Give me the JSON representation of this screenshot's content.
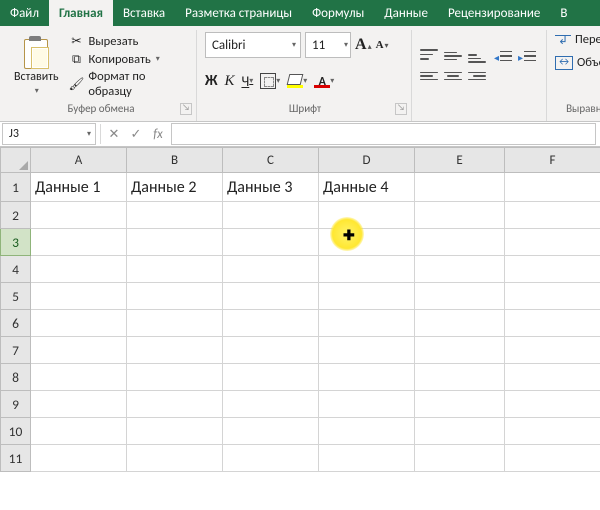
{
  "tabs": {
    "file": "Файл",
    "home": "Главная",
    "insert": "Вставка",
    "pagelayout": "Разметка страницы",
    "formulas": "Формулы",
    "data": "Данные",
    "review": "Рецензирование",
    "view_initial": "В"
  },
  "clipboard": {
    "paste": "Вставить",
    "cut": "Вырезать",
    "copy": "Копировать",
    "format_painter": "Формат по образцу",
    "group_label": "Буфер обмена"
  },
  "font": {
    "name": "Calibri",
    "size": "11",
    "bold": "Ж",
    "italic": "К",
    "underline": "Ч",
    "group_label": "Шрифт",
    "color_letter": "А"
  },
  "alignment": {
    "wrap": "Перенос",
    "merge": "Объеди",
    "group_label": "Выравниван"
  },
  "namebox": {
    "ref": "J3",
    "fx": "fx"
  },
  "columns": [
    "A",
    "B",
    "C",
    "D",
    "E",
    "F"
  ],
  "rows": [
    "1",
    "2",
    "3",
    "4",
    "5",
    "6",
    "7",
    "8",
    "9",
    "10",
    "11"
  ],
  "cells": {
    "A1": "Данные 1",
    "B1": "Данные 2",
    "C1": "Данные 3",
    "D1": "Данные 4"
  }
}
